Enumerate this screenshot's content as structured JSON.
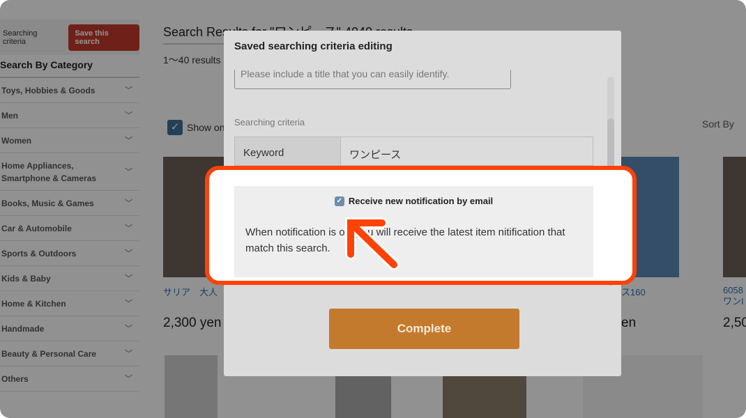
{
  "sidebar": {
    "criteria_label": "Searching criteria",
    "save_button": "Save this search",
    "category_heading": "Search By Category",
    "categories": [
      "Toys, Hobbies & Goods",
      "Men",
      "Women",
      "Home Appliances, Smartphone & Cameras",
      "Books, Music & Games",
      "Car & Automobile",
      "Sports & Outdoors",
      "Kids & Baby",
      "Home & Kitchen",
      "Handmade",
      "Beauty & Personal Care",
      "Others"
    ]
  },
  "main": {
    "title": "Search Results for \"ワンピース\" 4040 results",
    "count": "1〜40 results",
    "show_only": "Show on",
    "sort_by": "Sort By",
    "items": [
      {
        "name": "サリア　大人",
        "price": "2,300 yen"
      },
      {
        "name": "ス160",
        "price": "en"
      },
      {
        "name": "6058",
        "name2": "ワンI",
        "price": "2,50"
      }
    ]
  },
  "modal": {
    "title": "Saved searching criteria editing",
    "title_placeholder": "Please include a title that you can easily identify.",
    "criteria_label": "Searching criteria",
    "keyword_label": "Keyword",
    "keyword_value": "ワンピース",
    "notification_label": "Receive new notification by email",
    "notification_checked": true,
    "notification_desc": "When notification is on, you will receive the latest item nitification that match this search.",
    "complete_button": "Complete"
  },
  "colors": {
    "highlight": "#ff4208",
    "complete": "#c47a2c",
    "save": "#c0392b"
  }
}
